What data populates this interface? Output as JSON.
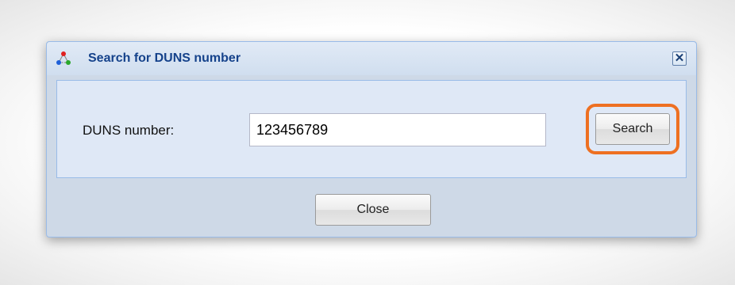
{
  "dialog": {
    "title": "Search for DUNS number",
    "title_icon": "network-icon",
    "close_glyph": "✕"
  },
  "form": {
    "duns_label": "DUNS number:",
    "duns_value": "123456789"
  },
  "buttons": {
    "search_label": "Search",
    "close_label": "Close"
  },
  "colors": {
    "title": "#15428b",
    "highlight": "#ee7022",
    "panel": "#dfe8f6"
  }
}
